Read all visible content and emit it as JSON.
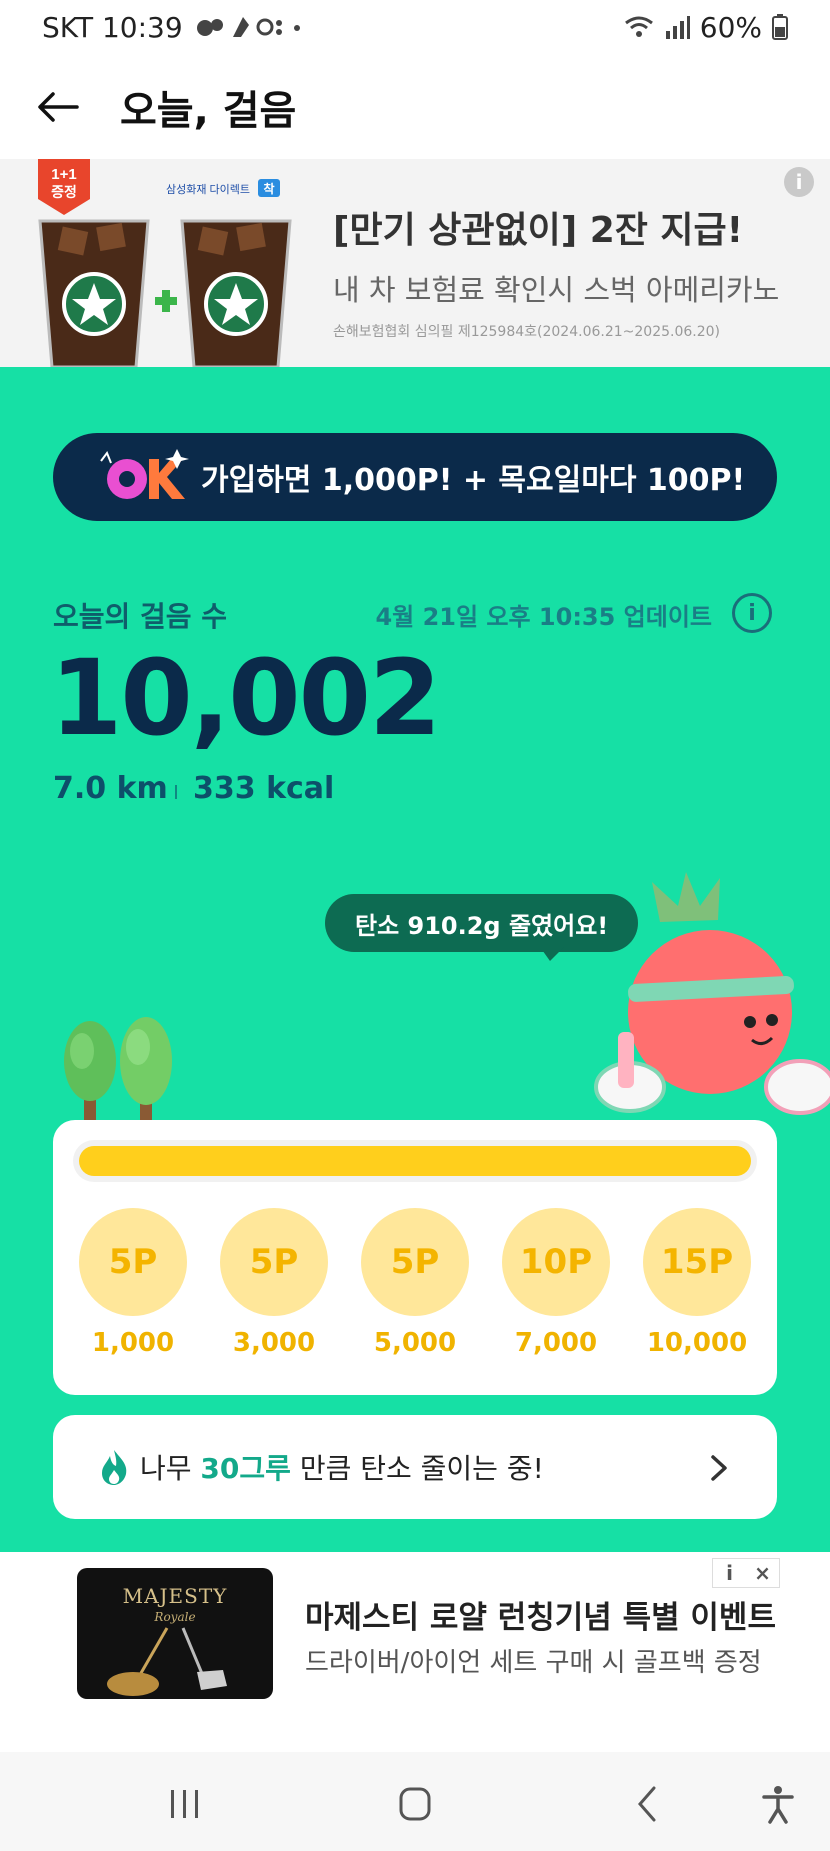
{
  "status_bar": {
    "carrier_time": "SKT 10:39",
    "battery": "60%"
  },
  "header": {
    "title": "오늘, 걸음"
  },
  "top_ad": {
    "badge": "1+1\n증정",
    "brand": "삼성화재 다이렉트",
    "brand_mark": "착",
    "title": "[만기 상관없이] 2잔 지급!",
    "subtitle": "내 차 보험료 확인시 스벅 아메리카노",
    "fine_print": "손해보험협회 심의필 제125984호(2024.06.21~2025.06.20)"
  },
  "promo": {
    "text": "가입하면 1,000P! + 목요일마다 100P!",
    "logo": "OK"
  },
  "steps": {
    "label": "오늘의 걸음 수",
    "updated": "4월 21일 오후 10:35 업데이트",
    "count": "10,002",
    "distance": "7.0 km",
    "calories": "333 kcal"
  },
  "carbon_bubble": "탄소 910.2g 줄였어요!",
  "progress": {
    "fraction": 1.0,
    "milestones": [
      {
        "points": "5P",
        "steps": "1,000"
      },
      {
        "points": "5P",
        "steps": "3,000"
      },
      {
        "points": "5P",
        "steps": "5,000"
      },
      {
        "points": "10P",
        "steps": "7,000"
      },
      {
        "points": "15P",
        "steps": "10,000"
      }
    ]
  },
  "trees_card": {
    "prefix": "나무 ",
    "highlight": "30그루",
    "suffix": " 만큼 탄소 줄이는 중!"
  },
  "bottom_ad": {
    "image_brand": "MAJESTY",
    "image_sub": "Royale",
    "title": "마제스티 로얄 런칭기념 특별 이벤트",
    "subtitle": "드라이버/아이언 세트 구매 시 골프백 증정",
    "info_label": "i",
    "close_label": "×"
  },
  "colors": {
    "green_bg": "#16e0a5",
    "navy": "#0b2a4a",
    "yellow": "#ffcf1c",
    "accent_green": "#13a98a"
  }
}
